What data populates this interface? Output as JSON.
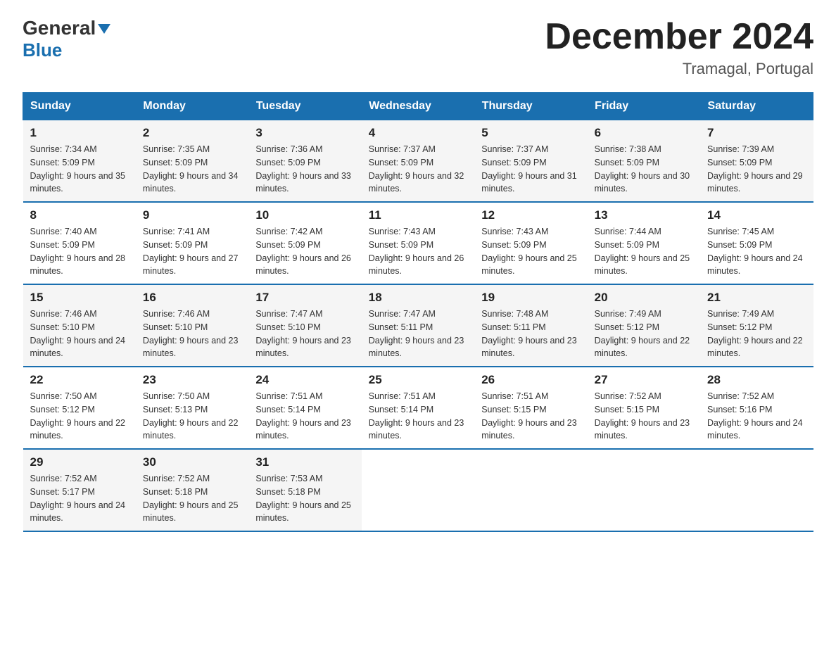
{
  "header": {
    "logo_line1": "General",
    "logo_line2": "Blue",
    "month_title": "December 2024",
    "location": "Tramagal, Portugal"
  },
  "days_of_week": [
    "Sunday",
    "Monday",
    "Tuesday",
    "Wednesday",
    "Thursday",
    "Friday",
    "Saturday"
  ],
  "weeks": [
    [
      {
        "day": "1",
        "sunrise": "Sunrise: 7:34 AM",
        "sunset": "Sunset: 5:09 PM",
        "daylight": "Daylight: 9 hours and 35 minutes."
      },
      {
        "day": "2",
        "sunrise": "Sunrise: 7:35 AM",
        "sunset": "Sunset: 5:09 PM",
        "daylight": "Daylight: 9 hours and 34 minutes."
      },
      {
        "day": "3",
        "sunrise": "Sunrise: 7:36 AM",
        "sunset": "Sunset: 5:09 PM",
        "daylight": "Daylight: 9 hours and 33 minutes."
      },
      {
        "day": "4",
        "sunrise": "Sunrise: 7:37 AM",
        "sunset": "Sunset: 5:09 PM",
        "daylight": "Daylight: 9 hours and 32 minutes."
      },
      {
        "day": "5",
        "sunrise": "Sunrise: 7:37 AM",
        "sunset": "Sunset: 5:09 PM",
        "daylight": "Daylight: 9 hours and 31 minutes."
      },
      {
        "day": "6",
        "sunrise": "Sunrise: 7:38 AM",
        "sunset": "Sunset: 5:09 PM",
        "daylight": "Daylight: 9 hours and 30 minutes."
      },
      {
        "day": "7",
        "sunrise": "Sunrise: 7:39 AM",
        "sunset": "Sunset: 5:09 PM",
        "daylight": "Daylight: 9 hours and 29 minutes."
      }
    ],
    [
      {
        "day": "8",
        "sunrise": "Sunrise: 7:40 AM",
        "sunset": "Sunset: 5:09 PM",
        "daylight": "Daylight: 9 hours and 28 minutes."
      },
      {
        "day": "9",
        "sunrise": "Sunrise: 7:41 AM",
        "sunset": "Sunset: 5:09 PM",
        "daylight": "Daylight: 9 hours and 27 minutes."
      },
      {
        "day": "10",
        "sunrise": "Sunrise: 7:42 AM",
        "sunset": "Sunset: 5:09 PM",
        "daylight": "Daylight: 9 hours and 26 minutes."
      },
      {
        "day": "11",
        "sunrise": "Sunrise: 7:43 AM",
        "sunset": "Sunset: 5:09 PM",
        "daylight": "Daylight: 9 hours and 26 minutes."
      },
      {
        "day": "12",
        "sunrise": "Sunrise: 7:43 AM",
        "sunset": "Sunset: 5:09 PM",
        "daylight": "Daylight: 9 hours and 25 minutes."
      },
      {
        "day": "13",
        "sunrise": "Sunrise: 7:44 AM",
        "sunset": "Sunset: 5:09 PM",
        "daylight": "Daylight: 9 hours and 25 minutes."
      },
      {
        "day": "14",
        "sunrise": "Sunrise: 7:45 AM",
        "sunset": "Sunset: 5:09 PM",
        "daylight": "Daylight: 9 hours and 24 minutes."
      }
    ],
    [
      {
        "day": "15",
        "sunrise": "Sunrise: 7:46 AM",
        "sunset": "Sunset: 5:10 PM",
        "daylight": "Daylight: 9 hours and 24 minutes."
      },
      {
        "day": "16",
        "sunrise": "Sunrise: 7:46 AM",
        "sunset": "Sunset: 5:10 PM",
        "daylight": "Daylight: 9 hours and 23 minutes."
      },
      {
        "day": "17",
        "sunrise": "Sunrise: 7:47 AM",
        "sunset": "Sunset: 5:10 PM",
        "daylight": "Daylight: 9 hours and 23 minutes."
      },
      {
        "day": "18",
        "sunrise": "Sunrise: 7:47 AM",
        "sunset": "Sunset: 5:11 PM",
        "daylight": "Daylight: 9 hours and 23 minutes."
      },
      {
        "day": "19",
        "sunrise": "Sunrise: 7:48 AM",
        "sunset": "Sunset: 5:11 PM",
        "daylight": "Daylight: 9 hours and 23 minutes."
      },
      {
        "day": "20",
        "sunrise": "Sunrise: 7:49 AM",
        "sunset": "Sunset: 5:12 PM",
        "daylight": "Daylight: 9 hours and 22 minutes."
      },
      {
        "day": "21",
        "sunrise": "Sunrise: 7:49 AM",
        "sunset": "Sunset: 5:12 PM",
        "daylight": "Daylight: 9 hours and 22 minutes."
      }
    ],
    [
      {
        "day": "22",
        "sunrise": "Sunrise: 7:50 AM",
        "sunset": "Sunset: 5:12 PM",
        "daylight": "Daylight: 9 hours and 22 minutes."
      },
      {
        "day": "23",
        "sunrise": "Sunrise: 7:50 AM",
        "sunset": "Sunset: 5:13 PM",
        "daylight": "Daylight: 9 hours and 22 minutes."
      },
      {
        "day": "24",
        "sunrise": "Sunrise: 7:51 AM",
        "sunset": "Sunset: 5:14 PM",
        "daylight": "Daylight: 9 hours and 23 minutes."
      },
      {
        "day": "25",
        "sunrise": "Sunrise: 7:51 AM",
        "sunset": "Sunset: 5:14 PM",
        "daylight": "Daylight: 9 hours and 23 minutes."
      },
      {
        "day": "26",
        "sunrise": "Sunrise: 7:51 AM",
        "sunset": "Sunset: 5:15 PM",
        "daylight": "Daylight: 9 hours and 23 minutes."
      },
      {
        "day": "27",
        "sunrise": "Sunrise: 7:52 AM",
        "sunset": "Sunset: 5:15 PM",
        "daylight": "Daylight: 9 hours and 23 minutes."
      },
      {
        "day": "28",
        "sunrise": "Sunrise: 7:52 AM",
        "sunset": "Sunset: 5:16 PM",
        "daylight": "Daylight: 9 hours and 24 minutes."
      }
    ],
    [
      {
        "day": "29",
        "sunrise": "Sunrise: 7:52 AM",
        "sunset": "Sunset: 5:17 PM",
        "daylight": "Daylight: 9 hours and 24 minutes."
      },
      {
        "day": "30",
        "sunrise": "Sunrise: 7:52 AM",
        "sunset": "Sunset: 5:18 PM",
        "daylight": "Daylight: 9 hours and 25 minutes."
      },
      {
        "day": "31",
        "sunrise": "Sunrise: 7:53 AM",
        "sunset": "Sunset: 5:18 PM",
        "daylight": "Daylight: 9 hours and 25 minutes."
      },
      null,
      null,
      null,
      null
    ]
  ]
}
